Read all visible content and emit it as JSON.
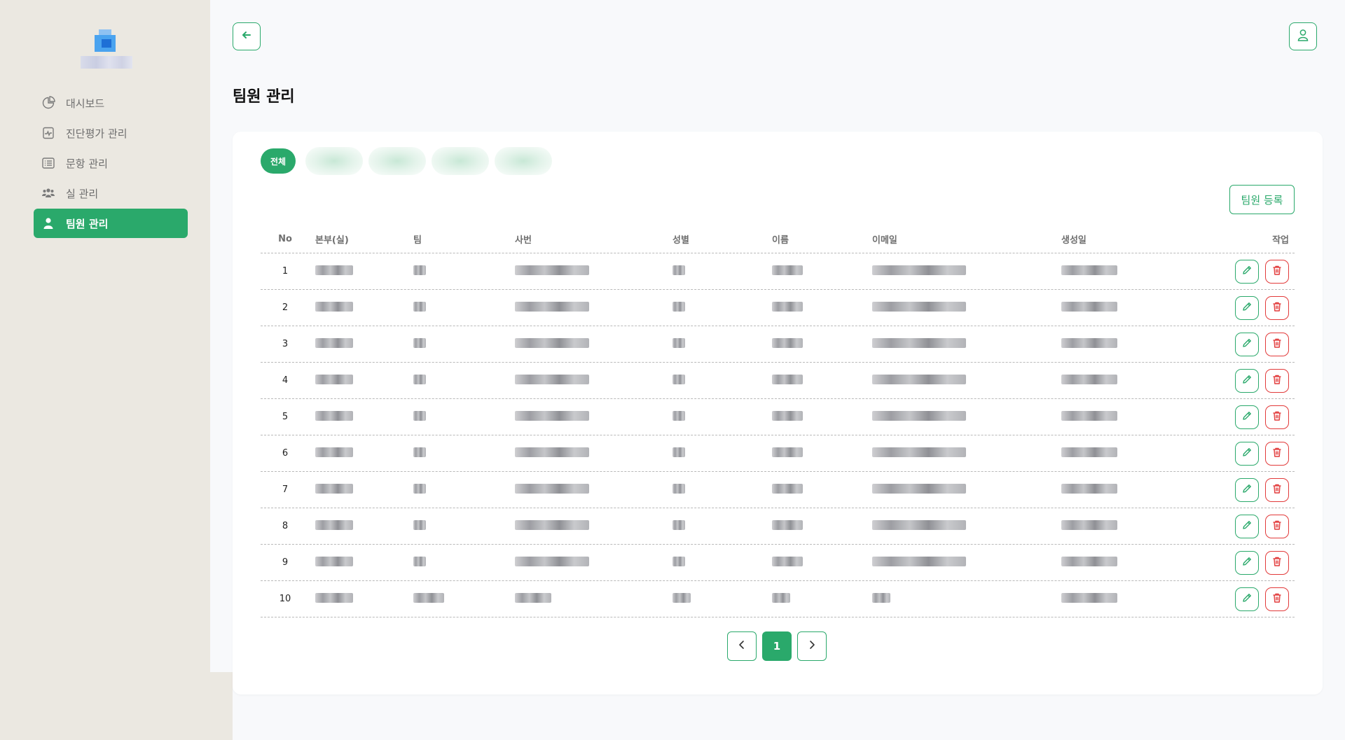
{
  "sidebar": {
    "items": [
      {
        "label": "대시보드",
        "icon": "pie-chart-icon"
      },
      {
        "label": "진단평가 관리",
        "icon": "diagnosis-icon"
      },
      {
        "label": "문항 관리",
        "icon": "list-icon"
      },
      {
        "label": "실 관리",
        "icon": "group-icon"
      },
      {
        "label": "팀원 관리",
        "icon": "user-icon",
        "active": true
      }
    ]
  },
  "header": {
    "back_icon": "arrow-left-icon",
    "user_icon": "user-icon"
  },
  "page": {
    "title": "팀원 관리"
  },
  "filters": {
    "all_label": "전체"
  },
  "actions": {
    "register_label": "팀원 등록"
  },
  "table": {
    "headers": {
      "no": "No",
      "dept": "본부(실)",
      "team": "팀",
      "emp": "사번",
      "gender": "성별",
      "name": "이름",
      "email": "이메일",
      "birth": "생성일",
      "actions": "작업"
    },
    "rows": [
      {
        "no": "1"
      },
      {
        "no": "2"
      },
      {
        "no": "3"
      },
      {
        "no": "4"
      },
      {
        "no": "5"
      },
      {
        "no": "6"
      },
      {
        "no": "7"
      },
      {
        "no": "8"
      },
      {
        "no": "9"
      },
      {
        "no": "10"
      }
    ]
  },
  "pagination": {
    "current": "1"
  },
  "colors": {
    "accent": "#2aa96b",
    "danger": "#e23a3a",
    "sidebar_bg": "#ebe8e1"
  }
}
